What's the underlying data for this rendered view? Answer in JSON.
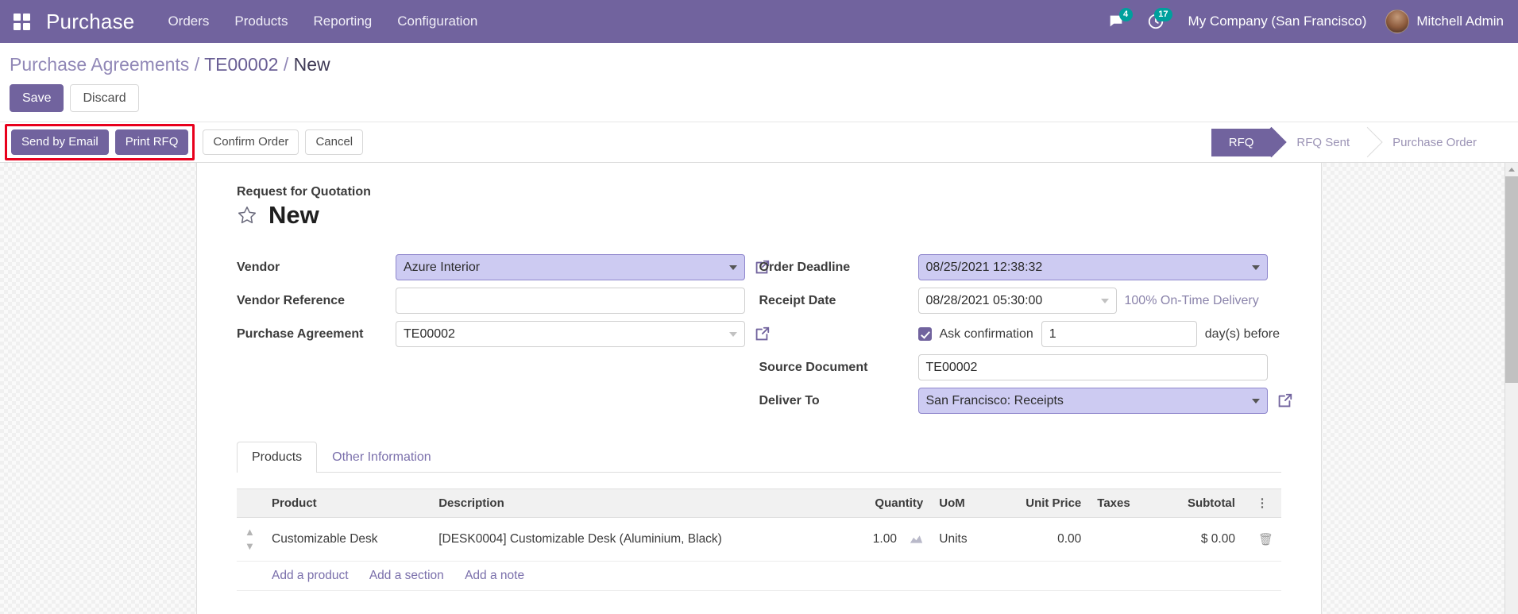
{
  "topbar": {
    "apps_icon": "apps-grid-icon",
    "brand": "Purchase",
    "menus": [
      {
        "label": "Orders"
      },
      {
        "label": "Products"
      },
      {
        "label": "Reporting"
      },
      {
        "label": "Configuration"
      }
    ],
    "messages_icon": "chat-bubble-icon",
    "messages_count": "4",
    "activities_icon": "clock-icon",
    "activities_count": "17",
    "company": "My Company (San Francisco)",
    "user": "Mitchell Admin",
    "avatar_icon": "user-avatar"
  },
  "breadcrumb": {
    "root": "Purchase Agreements",
    "sep1": "/",
    "mid": "TE00002",
    "sep2": "/",
    "current": "New"
  },
  "savebar": {
    "save": "Save",
    "discard": "Discard"
  },
  "actionbar": {
    "highlighted": [
      {
        "label": "Send by Email",
        "name": "send-by-email-button"
      },
      {
        "label": "Print RFQ",
        "name": "print-rfq-button"
      }
    ],
    "others": [
      {
        "label": "Confirm Order",
        "name": "confirm-order-button"
      },
      {
        "label": "Cancel",
        "name": "cancel-button"
      }
    ],
    "statuses": [
      {
        "label": "RFQ",
        "active": true
      },
      {
        "label": "RFQ Sent",
        "active": false
      },
      {
        "label": "Purchase Order",
        "active": false
      }
    ]
  },
  "form": {
    "subtitle": "Request for Quotation",
    "favorite_icon": "star-outline-icon",
    "title": "New",
    "left": {
      "vendor_label": "Vendor",
      "vendor_value": "Azure Interior",
      "vendor_ref_label": "Vendor Reference",
      "vendor_ref_value": "",
      "purchase_agreement_label": "Purchase Agreement",
      "purchase_agreement_value": "TE00002"
    },
    "right": {
      "order_deadline_label": "Order Deadline",
      "order_deadline_value": "08/25/2021 12:38:32",
      "receipt_date_label": "Receipt Date",
      "receipt_date_value": "08/28/2021 05:30:00",
      "on_time_delivery": "100% On-Time Delivery",
      "ask_confirmation_label": "Ask confirmation",
      "ask_confirmation_checked": true,
      "days_before_value": "1",
      "days_before_suffix": "day(s) before",
      "source_document_label": "Source Document",
      "source_document_value": "TE00002",
      "deliver_to_label": "Deliver To",
      "deliver_to_value": "San Francisco: Receipts"
    }
  },
  "tabs": [
    {
      "label": "Products",
      "active": true
    },
    {
      "label": "Other Information",
      "active": false
    }
  ],
  "lines_table": {
    "columns": [
      "Product",
      "Description",
      "Quantity",
      "UoM",
      "Unit Price",
      "Taxes",
      "Subtotal"
    ],
    "options_icon": "vertical-dots-icon",
    "rows": [
      {
        "handle_icon": "drag-handle-icon",
        "product": "Customizable Desk",
        "description": "[DESK0004] Customizable Desk (Aluminium, Black)",
        "quantity": "1.00",
        "forecast_icon": "forecast-report-icon",
        "uom": "Units",
        "unit_price": "0.00",
        "taxes": "",
        "subtotal": "$ 0.00",
        "delete_icon": "trash-icon"
      }
    ],
    "add_links": [
      {
        "label": "Add a product",
        "name": "add-a-product-link"
      },
      {
        "label": "Add a section",
        "name": "add-a-section-link"
      },
      {
        "label": "Add a note",
        "name": "add-a-note-link"
      }
    ]
  },
  "colors": {
    "brand_purple": "#71639e",
    "highlight_field": "#cdcbf2",
    "highlight_border": "#e8001c",
    "badge_teal": "#00a09d"
  }
}
